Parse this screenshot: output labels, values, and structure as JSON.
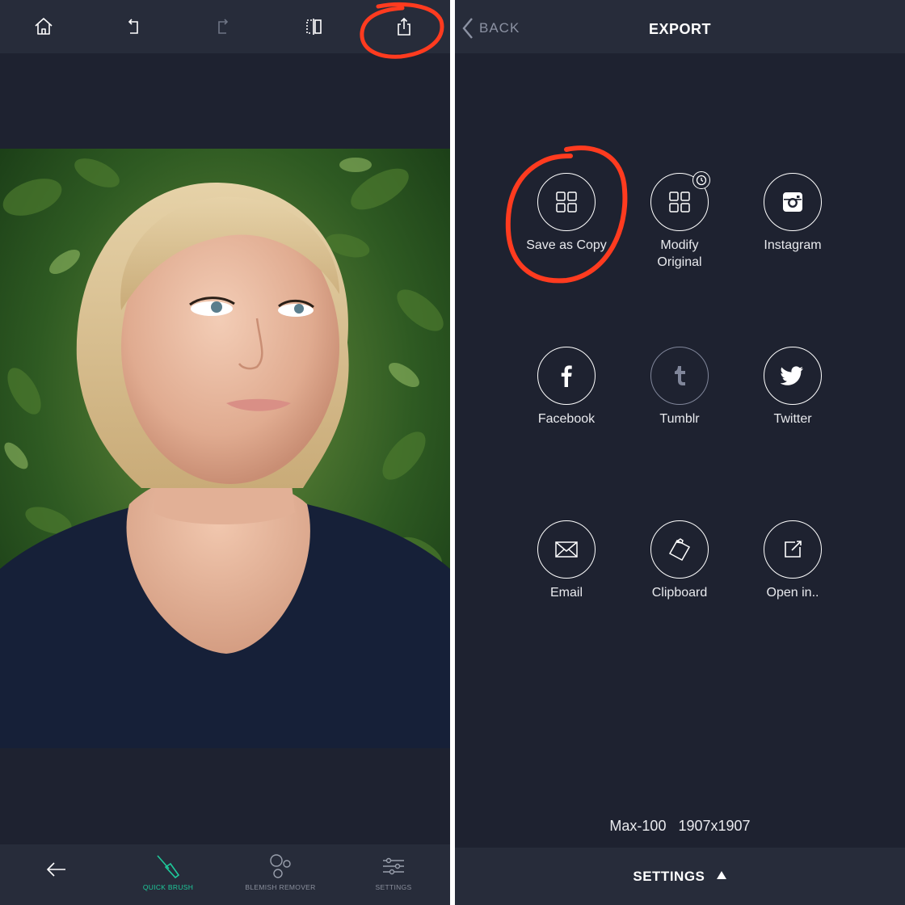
{
  "editor": {
    "toolbar": {
      "home_icon": "home-icon",
      "undo_icon": "undo-icon",
      "redo_icon": "redo-icon",
      "compare_icon": "compare-icon",
      "share_icon": "share-icon"
    },
    "photo": {
      "description_icon": "portrait-photo"
    },
    "bottom_tools": [
      {
        "label": "",
        "icon": "back-arrow-icon",
        "active": false
      },
      {
        "label": "QUICK BRUSH",
        "icon": "brush-icon",
        "active": true
      },
      {
        "label": "BLEMISH REMOVER",
        "icon": "blemish-icon",
        "active": false
      },
      {
        "label": "SETTINGS",
        "icon": "sliders-icon",
        "active": false
      }
    ]
  },
  "export": {
    "back_label": "BACK",
    "title": "EXPORT",
    "options": [
      {
        "label": "Save as Copy",
        "icon": "grid-icon"
      },
      {
        "label": "Modify\nOriginal",
        "icon": "grid-clock-icon"
      },
      {
        "label": "Instagram",
        "icon": "instagram-icon"
      },
      {
        "label": "Facebook",
        "icon": "facebook-icon"
      },
      {
        "label": "Tumblr",
        "icon": "tumblr-icon"
      },
      {
        "label": "Twitter",
        "icon": "twitter-icon"
      },
      {
        "label": "Email",
        "icon": "email-icon"
      },
      {
        "label": "Clipboard",
        "icon": "clipboard-icon"
      },
      {
        "label": "Open in..",
        "icon": "open-in-icon"
      }
    ],
    "quality": "Max-100",
    "dimensions": "1907x1907",
    "settings_label": "SETTINGS",
    "settings_icon": "triangle-up-icon"
  },
  "colors": {
    "panel_bg": "#1e2230",
    "bar_bg": "#272c3a",
    "accent_green": "#1ec99a",
    "annotation_red": "#ff3b1f"
  }
}
